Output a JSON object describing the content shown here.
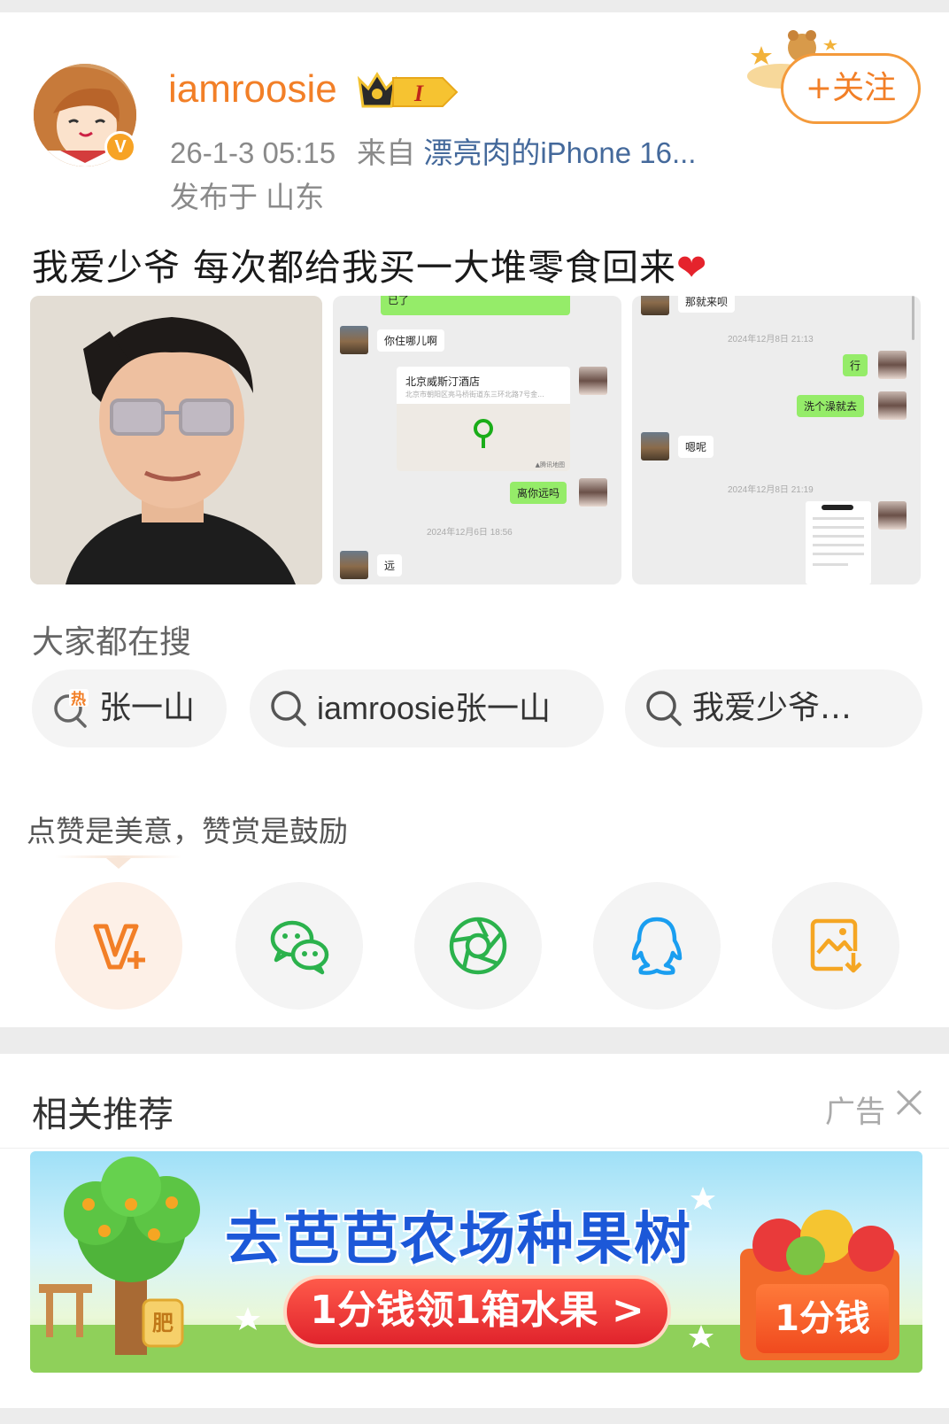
{
  "post": {
    "username": "iamroosie",
    "vip_level": "I",
    "verified_mark": "V",
    "timestamp": "26-1-3 05:15",
    "source_prefix": "来自",
    "source": "漂亮肉的iPhone 16...",
    "location": "发布于 山东",
    "follow_label": "+关注",
    "text": "我爱少爷 每次都给我买一大堆零食回来",
    "text_emoji": "❤"
  },
  "chat_images": {
    "img2": {
      "top_bubble": "已了",
      "q1": "你住哪儿啊",
      "location_title": "北京威斯汀酒店",
      "location_addr": "北京市朝阳区亮马桥街道东三环北路7号金...",
      "map_credit": "▲腾讯地图",
      "q2": "离你远吗",
      "time": "2024年12月6日 18:56",
      "reply": "远"
    },
    "img3": {
      "top_msg": "那就来呗",
      "time1": "2024年12月8日 21:13",
      "m1": "行",
      "m2": "洗个澡就去",
      "r1": "嗯呢",
      "time2": "2024年12月8日 21:19"
    }
  },
  "search": {
    "title": "大家都在搜",
    "chips": [
      {
        "label": "张一山",
        "icon": "hot-search-icon"
      },
      {
        "label": "iamroosie张一山",
        "icon": "search-icon"
      },
      {
        "label": "我爱少爷…",
        "icon": "search-icon"
      }
    ]
  },
  "reward": {
    "text": "点赞是美意，赞赏是鼓励"
  },
  "share": [
    {
      "name": "reward-v-plus",
      "color": "#f27f27"
    },
    {
      "name": "wechat",
      "color": "#2bb24c"
    },
    {
      "name": "moments",
      "color": "#2bb24c"
    },
    {
      "name": "qq",
      "color": "#1a9ef0"
    },
    {
      "name": "save-image",
      "color": "#f5a623"
    }
  ],
  "recommend": {
    "title": "相关推荐",
    "ad_label": "广告"
  },
  "banner": {
    "headline": "去芭芭农场种果树",
    "cta": "1分钱领1箱水果 >",
    "price": "1分钱",
    "fertilizer": "肥"
  }
}
